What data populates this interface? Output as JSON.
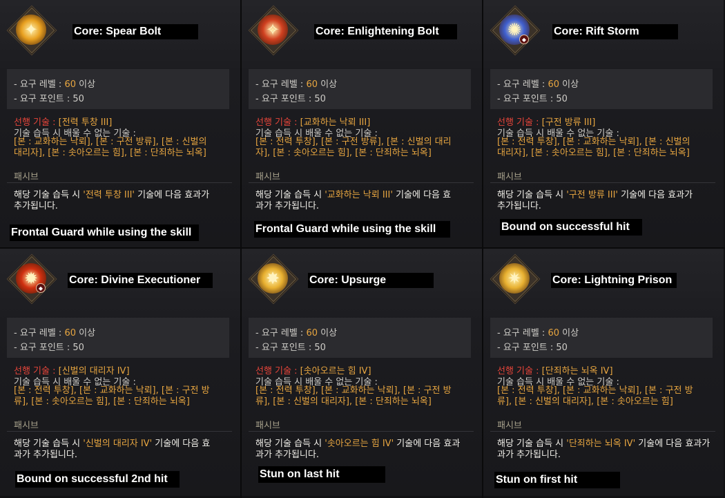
{
  "cards": [
    {
      "title": "Core: Spear Bolt",
      "req_level_label": "- 요구 레벨 : ",
      "req_level": "60",
      "req_level_suffix": " 이상",
      "req_points": "- 요구 포인트 : 50",
      "prereq_label": "선행 기술 : ",
      "prereq_value": "[전력 투창 III]",
      "unlearn_label": "기술 습득 시 배울 수 없는 기술 :",
      "skills_line1": "[본 : 교화하는 낙뢰], [본 : 구전 방류], [본 : 신벌의",
      "skills_line2": "대리자], [본 : 솟아오르는 힘], [본 : 단죄하는 뇌옥]",
      "passive": "패시브",
      "desc_pre": "해당 기술 습득 시 ",
      "desc_hl": "'전력 투창 III'",
      "desc_post": " 기술에 다음 효과가",
      "desc_line2": "추가됩니다.",
      "effect": "Frontal Guard while using the skill",
      "icon": "spear-bolt-icon",
      "icon_color": "#e8a020"
    },
    {
      "title": "Core: Enlightening Bolt",
      "req_level_label": "- 요구 레벨 : ",
      "req_level": "60",
      "req_level_suffix": " 이상",
      "req_points": "- 요구 포인트 : 50",
      "prereq_label": "선행 기술 : ",
      "prereq_value": "[교화하는 낙뢰 III]",
      "unlearn_label": "기술 습득 시 배울 수 없는 기술 :",
      "skills_line1": "[본 : 전력 투창], [본 : 구전 방류], [본 : 신벌의 대리",
      "skills_line2": "자], [본 : 솟아오르는 힘], [본 : 단죄하는 뇌옥]",
      "passive": "패시브",
      "desc_pre": "해당 기술 습득 시 ",
      "desc_hl": "'교화하는 낙뢰 III'",
      "desc_post": " 기술에 다음 효",
      "desc_line2": "과가 추가됩니다.",
      "effect": "Frontal Guard while using the skill",
      "icon": "enlightening-bolt-icon",
      "icon_color": "#d04020"
    },
    {
      "title": "Core: Rift Storm",
      "req_level_label": "- 요구 레벨 : ",
      "req_level": "60",
      "req_level_suffix": " 이상",
      "req_points": "- 요구 포인트 : 50",
      "prereq_label": "선행 기술 : ",
      "prereq_value": "[구전 방류 III]",
      "unlearn_label": "기술 습득 시 배울 수 없는 기술 :",
      "skills_line1": "[본 : 전력 투창], [본 : 교화하는 낙뢰], [본 : 신벌의",
      "skills_line2": "대리자], [본 : 솟아오르는 힘], [본 : 단죄하는 뇌옥]",
      "passive": "패시브",
      "desc_pre": "해당 기술 습득 시 ",
      "desc_hl": "'구전 방류 III'",
      "desc_post": " 기술에 다음 효과가",
      "desc_line2": "추가됩니다.",
      "effect": "Bound on successful hit",
      "icon": "rift-storm-icon",
      "icon_color": "#4060d0"
    },
    {
      "title": "Core: Divine Executioner",
      "req_level_label": "- 요구 레벨 : ",
      "req_level": "60",
      "req_level_suffix": " 이상",
      "req_points": "- 요구 포인트 : 50",
      "prereq_label": "선행 기술 : ",
      "prereq_value": "[신벌의 대리자 IV]",
      "unlearn_label": "기술 습득 시 배울 수 없는 기술 :",
      "skills_line1": "[본 : 전력 투창], [본 : 교화하는 낙뢰], [본 : 구전 방",
      "skills_line2": "류], [본 : 솟아오르는 힘], [본 : 단죄하는 뇌옥]",
      "passive": "패시브",
      "desc_pre": "해당 기술 습득 시 ",
      "desc_hl": "'신벌의 대리자 IV'",
      "desc_post": " 기술에 다음 효",
      "desc_line2": "과가 추가됩니다.",
      "effect": "Bound on successful 2nd hit",
      "icon": "divine-executioner-icon",
      "icon_color": "#d03010"
    },
    {
      "title": "Core: Upsurge",
      "req_level_label": "- 요구 레벨 : ",
      "req_level": "60",
      "req_level_suffix": " 이상",
      "req_points": "- 요구 포인트 : 50",
      "prereq_label": "선행 기술 : ",
      "prereq_value": "[솟아오르는 힘 IV]",
      "unlearn_label": "기술 습득 시 배울 수 없는 기술 :",
      "skills_line1": "[본 : 전력 투창], [본 : 교화하는 낙뢰], [본 : 구전 방",
      "skills_line2": "류], [본 : 신벌의 대리자], [본 : 단죄하는 뇌옥]",
      "passive": "패시브",
      "desc_pre": "해당 기술 습득 시 ",
      "desc_hl": "'솟아오르는 힘 IV'",
      "desc_post": " 기술에 다음 효과",
      "desc_line2": "과가 추가됩니다.",
      "effect": "Stun on last hit",
      "icon": "upsurge-icon",
      "icon_color": "#e8b030"
    },
    {
      "title": "Core: Lightning Prison",
      "req_level_label": "- 요구 레벨 : ",
      "req_level": "60",
      "req_level_suffix": " 이상",
      "req_points": "- 요구 포인트 : 50",
      "prereq_label": "선행 기술 : ",
      "prereq_value": "[단죄하는 뇌옥 IV]",
      "unlearn_label": "기술 습득 시 배울 수 없는 기술 :",
      "skills_line1": "[본 : 전력 투창], [본 : 교화하는 낙뢰], [본 : 구전 방",
      "skills_line2": "류], [본 : 신벌의 대리자], [본 : 솟아오르는 힘]",
      "passive": "패시브",
      "desc_pre": "해당 기술 습득 시 ",
      "desc_hl": "'단죄하는 뇌옥 IV'",
      "desc_post": " 기술에 다음 효과가",
      "desc_line2": "과가 추가됩니다.",
      "effect": "Stun on first hit",
      "icon": "lightning-prison-icon",
      "icon_color": "#e8b030"
    }
  ]
}
